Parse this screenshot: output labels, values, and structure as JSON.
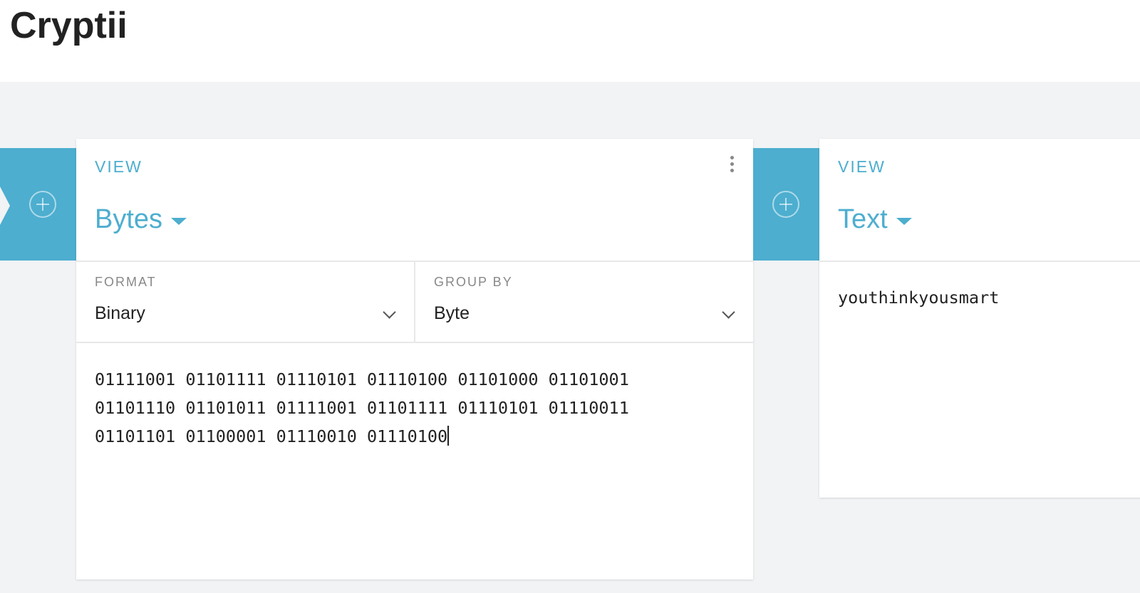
{
  "app": {
    "title": "Cryptii"
  },
  "bricks": [
    {
      "type": "VIEW",
      "name": "Bytes",
      "settings": [
        {
          "label": "FORMAT",
          "value": "Binary"
        },
        {
          "label": "GROUP BY",
          "value": "Byte"
        }
      ],
      "content": "01111001 01101111 01110101 01110100 01101000 01101001\n01101110 01101011 01111001 01101111 01110101 01110011\n01101101 01100001 01110010 01110100"
    },
    {
      "type": "VIEW",
      "name": "Text",
      "content": "youthinkyousmart"
    }
  ],
  "colors": {
    "accent": "#4daecf",
    "background": "#f1f3f5",
    "header": "#ffffff",
    "text": "#222222",
    "muted": "#888888"
  },
  "icons": {
    "add": "plus-circle-icon",
    "menu": "more-vertical-icon",
    "dropdown": "caret-down-icon",
    "select": "chevron-down-icon"
  }
}
